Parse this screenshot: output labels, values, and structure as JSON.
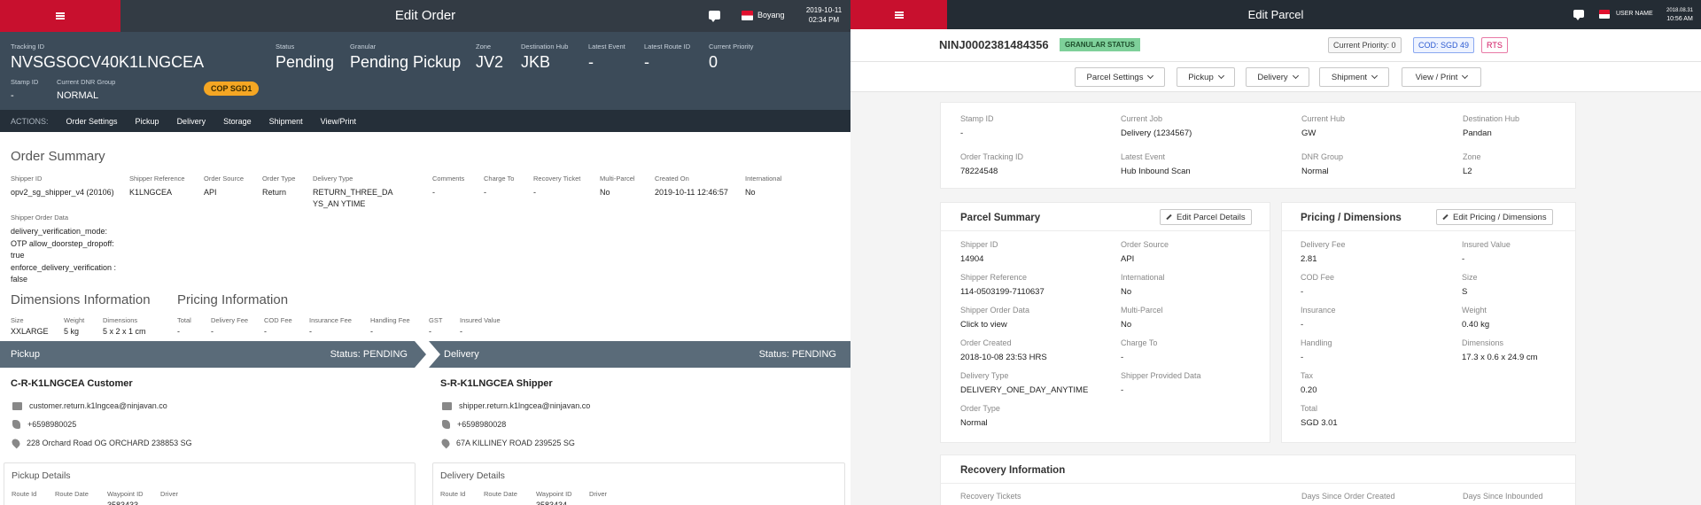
{
  "left": {
    "topbar": {
      "title": "Edit Order",
      "user": "Boyang",
      "date": "2019-10-11",
      "time": "02:34 PM"
    },
    "order": {
      "tracking_label": "Tracking ID",
      "tracking_value": "NVSGSOCV40K1LNGCEA",
      "cop_badge": "COP SGD1",
      "status_label": "Status",
      "status_value": "Pending",
      "granular_label": "Granular",
      "granular_value": "Pending Pickup",
      "zone_label": "Zone",
      "zone_value": "JV2",
      "dest_label": "Destination Hub",
      "dest_value": "JKB",
      "latest_event_label": "Latest Event",
      "latest_event_value": "-",
      "latest_route_label": "Latest Route ID",
      "latest_route_value": "-",
      "priority_label": "Current Priority",
      "priority_value": "0",
      "stamp_label": "Stamp ID",
      "stamp_value": "-",
      "dnr_label": "Current DNR Group",
      "dnr_value": "NORMAL"
    },
    "actions": {
      "label": "ACTIONS:",
      "items": [
        "Order Settings",
        "Pickup",
        "Delivery",
        "Storage",
        "Shipment",
        "View/Print"
      ]
    },
    "summary": {
      "title": "Order Summary",
      "fields": [
        {
          "label": "Shipper ID",
          "value": "opv2_sg_shipper_v4 (20106)"
        },
        {
          "label": "Shipper Reference",
          "value": "K1LNGCEA"
        },
        {
          "label": "Order Source",
          "value": "API"
        },
        {
          "label": "Order Type",
          "value": "Return"
        },
        {
          "label": "Delivery Type",
          "value": "RETURN_THREE_DAYS_AN YTIME"
        },
        {
          "label": "Comments",
          "value": "-"
        },
        {
          "label": "Charge To",
          "value": "-"
        },
        {
          "label": "Recovery Ticket",
          "value": "-"
        },
        {
          "label": "Multi-Parcel",
          "value": "No"
        },
        {
          "label": "Created On",
          "value": "2019-10-11 12:46:57"
        },
        {
          "label": "International",
          "value": "No"
        }
      ],
      "shipper_data_label": "Shipper Order Data",
      "shipper_data_value": "delivery_verification_mode: OTP allow_doorstep_dropoff: true enforce_delivery_verification : false"
    },
    "dimensions": {
      "title": "Dimensions Information",
      "fields": [
        {
          "label": "Size",
          "value": "XXLARGE"
        },
        {
          "label": "Weight",
          "value": "5 kg"
        },
        {
          "label": "Dimensions",
          "value": "5 x 2 x 1 cm"
        }
      ]
    },
    "pricing": {
      "title": "Pricing Information",
      "fields": [
        {
          "label": "Total",
          "value": "-"
        },
        {
          "label": "Delivery Fee",
          "value": "-"
        },
        {
          "label": "COD Fee",
          "value": "-"
        },
        {
          "label": "Insurance Fee",
          "value": "-"
        },
        {
          "label": "Handling Fee",
          "value": "-"
        },
        {
          "label": "GST",
          "value": "-"
        },
        {
          "label": "Insured Value",
          "value": "-"
        }
      ]
    },
    "pickup": {
      "title": "Pickup",
      "status": "Status: PENDING",
      "name": "C-R-K1LNGCEA Customer",
      "email": "customer.return.k1lngcea@ninjavan.co",
      "phone": "+6598980025",
      "address": "228 Orchard Road OG ORCHARD 238853 SG",
      "details_title": "Pickup Details",
      "cols": [
        "Route Id",
        "Route Date",
        "Waypoint ID",
        "Driver"
      ],
      "waypoint": "3583433"
    },
    "delivery": {
      "title": "Delivery",
      "status": "Status: PENDING",
      "name": "S-R-K1LNGCEA Shipper",
      "email": "shipper.return.k1lngcea@ninjavan.co",
      "phone": "+6598980028",
      "address": "67A KILLINEY ROAD 239525 SG",
      "details_title": "Delivery Details",
      "cols": [
        "Route Id",
        "Route Date",
        "Waypoint ID",
        "Driver"
      ],
      "waypoint": "3583434"
    }
  },
  "right": {
    "topbar": {
      "title": "Edit Parcel",
      "user": "USER NAME",
      "date": "2018.08.31",
      "time": "10:56 AM"
    },
    "header": {
      "tracking": "NINJ0002381484356",
      "badge": "GRANULAR STATUS",
      "priority": "Current Priority: 0",
      "cod": "COD: SGD 49",
      "rts": "RTS"
    },
    "tools": [
      "Parcel Settings",
      "Pickup",
      "Delivery",
      "Shipment",
      "View / Print"
    ],
    "info": [
      {
        "label": "Stamp ID",
        "value": "-"
      },
      {
        "label": "Current Job",
        "value": "Delivery (1234567)"
      },
      {
        "label": "Current Hub",
        "value": "GW"
      },
      {
        "label": "Destination Hub",
        "value": "Pandan"
      },
      {
        "label": "Order Tracking ID",
        "value": "78224548"
      },
      {
        "label": "Latest Event",
        "value": "Hub Inbound Scan"
      },
      {
        "label": "DNR Group",
        "value": "Normal"
      },
      {
        "label": "Zone",
        "value": "L2"
      }
    ],
    "parcel_summary": {
      "title": "Parcel Summary",
      "edit": "Edit Parcel Details",
      "fields": [
        {
          "label": "Shipper ID",
          "value": "14904"
        },
        {
          "label": "Order Source",
          "value": "API"
        },
        {
          "label": "Shipper Reference",
          "value": "114-0503199-7110637"
        },
        {
          "label": "International",
          "value": "No"
        },
        {
          "label": "Shipper Order Data",
          "value": "Click to view"
        },
        {
          "label": "Multi-Parcel",
          "value": "No"
        },
        {
          "label": "Order Created",
          "value": "2018-10-08 23:53 HRS"
        },
        {
          "label": "Charge To",
          "value": "-"
        },
        {
          "label": "Delivery Type",
          "value": "DELIVERY_ONE_DAY_ANYTIME"
        },
        {
          "label": "Shipper Provided Data",
          "value": "-"
        },
        {
          "label": "Order Type",
          "value": "Normal"
        }
      ]
    },
    "pricing_dims": {
      "title": "Pricing / Dimensions",
      "edit": "Edit Pricing / Dimensions",
      "fields": [
        {
          "label": "Delivery Fee",
          "value": "2.81"
        },
        {
          "label": "Insured Value",
          "value": "-"
        },
        {
          "label": "COD Fee",
          "value": "-"
        },
        {
          "label": "Size",
          "value": "S"
        },
        {
          "label": "Insurance",
          "value": "-"
        },
        {
          "label": "Weight",
          "value": "0.40 kg"
        },
        {
          "label": "Handling",
          "value": "-"
        },
        {
          "label": "Dimensions",
          "value": "17.3 x 0.6 x 24.9 cm"
        },
        {
          "label": "Tax",
          "value": "0.20"
        },
        {
          "label": "Total",
          "value": "SGD 3.01"
        }
      ]
    },
    "recovery": {
      "title": "Recovery Information",
      "cols": [
        "Recovery Tickets",
        "Days Since Order Created",
        "Days Since Inbounded"
      ]
    }
  }
}
